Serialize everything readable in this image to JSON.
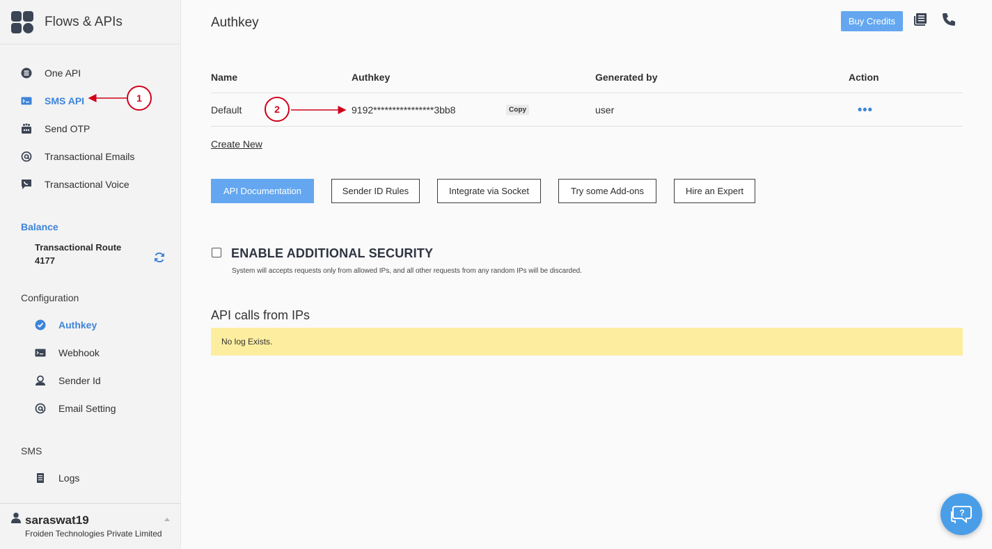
{
  "sidebar": {
    "brand": "Flows & APIs",
    "items": [
      {
        "label": "One API"
      },
      {
        "label": "SMS API"
      },
      {
        "label": "Send OTP"
      },
      {
        "label": "Transactional Emails"
      },
      {
        "label": "Transactional Voice"
      }
    ],
    "balance_label": "Balance",
    "balance_route": "Transactional Route",
    "balance_value": "4177",
    "config_label": "Configuration",
    "config_items": [
      {
        "label": "Authkey"
      },
      {
        "label": "Webhook"
      },
      {
        "label": "Sender Id"
      },
      {
        "label": "Email Setting"
      }
    ],
    "sms_label": "SMS",
    "sms_items": [
      {
        "label": "Logs"
      }
    ],
    "user": {
      "name": "saraswat19",
      "company": "Froiden Technologies Private Limited"
    }
  },
  "header": {
    "title": "Authkey",
    "buy_credits": "Buy Credits"
  },
  "table": {
    "columns": [
      "Name",
      "Authkey",
      "Generated by",
      "Action"
    ],
    "rows": [
      {
        "name": "Default",
        "authkey": "9192****************3bb8",
        "copy": "Copy",
        "generated_by": "user",
        "action": "•••"
      }
    ]
  },
  "create_new": "Create New",
  "buttons": {
    "api_docs": "API Documentation",
    "sender_rules": "Sender ID Rules",
    "socket": "Integrate via Socket",
    "addons": "Try some Add-ons",
    "expert": "Hire an Expert"
  },
  "security": {
    "title": "ENABLE ADDITIONAL SECURITY",
    "description": "System will accepts requests only from allowed IPs, and all other requests from any random IPs will be discarded."
  },
  "ip_calls": {
    "title": "API calls from IPs",
    "empty": "No log Exists."
  },
  "annotations": [
    "1",
    "2"
  ],
  "colors": {
    "accent": "#3d84d9",
    "button": "#64a7f0",
    "log_bg": "#fdee9f",
    "annotation": "#d0021b"
  }
}
